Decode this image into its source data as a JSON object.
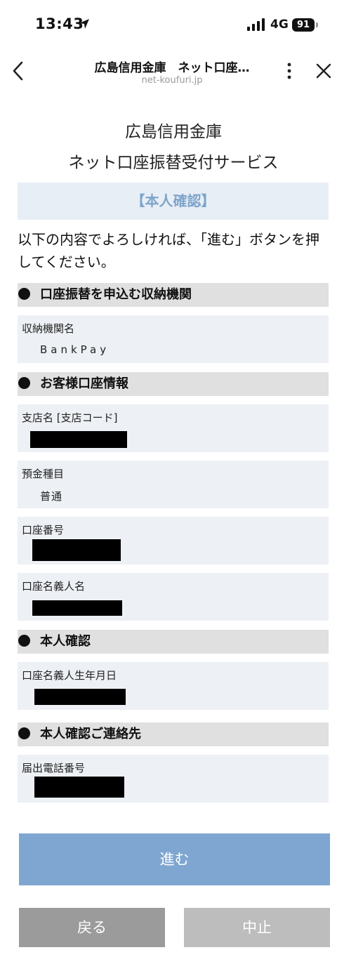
{
  "status_bar": {
    "time": "13:43",
    "network": "4G",
    "battery": "91"
  },
  "browser": {
    "title": "広島信用金庫　ネット口座…",
    "domain": "net-koufuri.jp"
  },
  "header": {
    "line1": "広島信用金庫",
    "line2": "ネット口座振替受付サービス"
  },
  "banner": "【本人確認】",
  "intro": "以下の内容でよろしければ、「進む」ボタンを押してください。",
  "sections": {
    "institution": "口座振替を申込む収納機関",
    "account": "お客様口座情報",
    "identity": "本人確認",
    "contact": "本人確認ご連絡先"
  },
  "fields": {
    "institution_name": {
      "label": "収納機関名",
      "value": "BankPay"
    },
    "branch": {
      "label": "支店名 [支店コード]",
      "value": ""
    },
    "deposit_type": {
      "label": "預金種目",
      "value": "普通"
    },
    "account_number": {
      "label": "口座番号",
      "value": ""
    },
    "account_holder": {
      "label": "口座名義人名",
      "value": ""
    },
    "birthdate": {
      "label": "口座名義人生年月日",
      "value": ""
    },
    "phone": {
      "label": "届出電話番号",
      "value": ""
    }
  },
  "buttons": {
    "next": "進む",
    "back": "戻る",
    "cancel": "中止"
  }
}
